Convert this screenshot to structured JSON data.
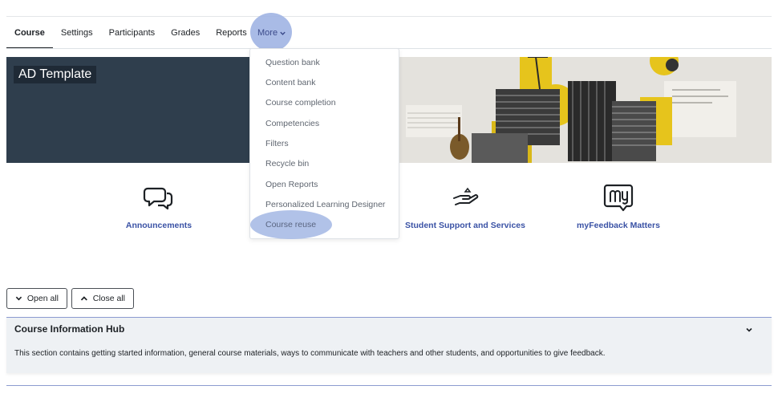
{
  "nav": {
    "items": [
      {
        "label": "Course",
        "active": true
      },
      {
        "label": "Settings",
        "active": false
      },
      {
        "label": "Participants",
        "active": false
      },
      {
        "label": "Grades",
        "active": false
      },
      {
        "label": "Reports",
        "active": false
      }
    ],
    "more_label": "More"
  },
  "more_menu": {
    "items": [
      "Question bank",
      "Content bank",
      "Course completion",
      "Competencies",
      "Filters",
      "Recycle bin",
      "Open Reports",
      "Personalized Learning Designer",
      "Course reuse"
    ]
  },
  "banner": {
    "course_title": "AD Template"
  },
  "quick_links": [
    {
      "label": "Announcements",
      "icon": "speech-bubbles-icon"
    },
    {
      "label": "Student Support and Services",
      "icon": "helping-hand-icon"
    },
    {
      "label": "myFeedback Matters",
      "icon": "my-feedback-icon"
    }
  ],
  "controls": {
    "open_all": "Open all",
    "close_all": "Close all"
  },
  "sections": [
    {
      "title": "Course Information Hub",
      "description": "This section contains getting started information, general course materials, ways to communicate with teachers and other students, and opportunities to give feedback."
    }
  ],
  "colors": {
    "link": "#3a52a5",
    "banner_bg": "#2f3e4d",
    "highlight": "#a0b4e3",
    "accent_yellow": "#e6c41c"
  }
}
